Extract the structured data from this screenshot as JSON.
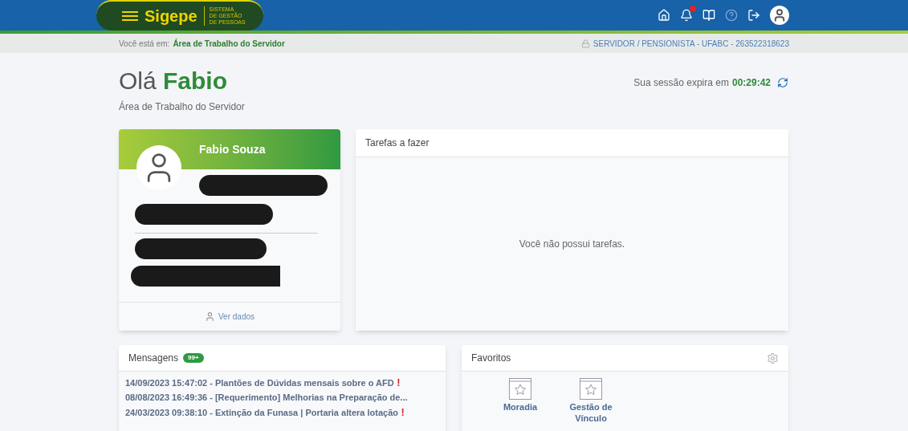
{
  "header": {
    "logo": {
      "name": "Sigepe",
      "subtitle": [
        "SISTEMA",
        "DE GESTÃO",
        "DE PESSOAS"
      ]
    },
    "icons": [
      {
        "kind": "home",
        "alert": false
      },
      {
        "kind": "bell",
        "alert": true
      },
      {
        "kind": "book",
        "alert": false
      },
      {
        "kind": "help",
        "alert": false
      },
      {
        "kind": "logout",
        "alert": false
      },
      {
        "kind": "avatar",
        "alert": false
      }
    ]
  },
  "breadcrumb": {
    "label": "Você está em:",
    "current": "Área de Trabalho do Servidor",
    "profile": "SERVIDOR / PENSIONISTA - UFABC - 263522318623"
  },
  "greeting": {
    "hello": "Olá",
    "name": "Fabio",
    "subtitle": "Área de Trabalho do Servidor"
  },
  "session": {
    "label": "Sua sessão expira em",
    "time": "00:29:42"
  },
  "profile_card": {
    "name": "Fabio Souza",
    "action": "Ver dados"
  },
  "tasks": {
    "title": "Tarefas a fazer",
    "empty": "Você não possui tarefas."
  },
  "messages": {
    "title": "Mensagens",
    "count": "99+",
    "items": [
      {
        "text": "14/09/2023 15:47:02 - Plantões de Dúvidas mensais sobre o AFD",
        "mark": "!"
      },
      {
        "text": "08/08/2023 16:49:36 - [Requerimento] Melhorias na Preparação de..."
      },
      {
        "text": "24/03/2023 09:38:10 - Extinção da Funasa | Portaria altera lotação",
        "mark": "!"
      }
    ]
  },
  "favorites": {
    "title": "Favoritos",
    "items": [
      {
        "label": "Moradia"
      },
      {
        "label": "Gestão de Vínculo"
      }
    ]
  }
}
